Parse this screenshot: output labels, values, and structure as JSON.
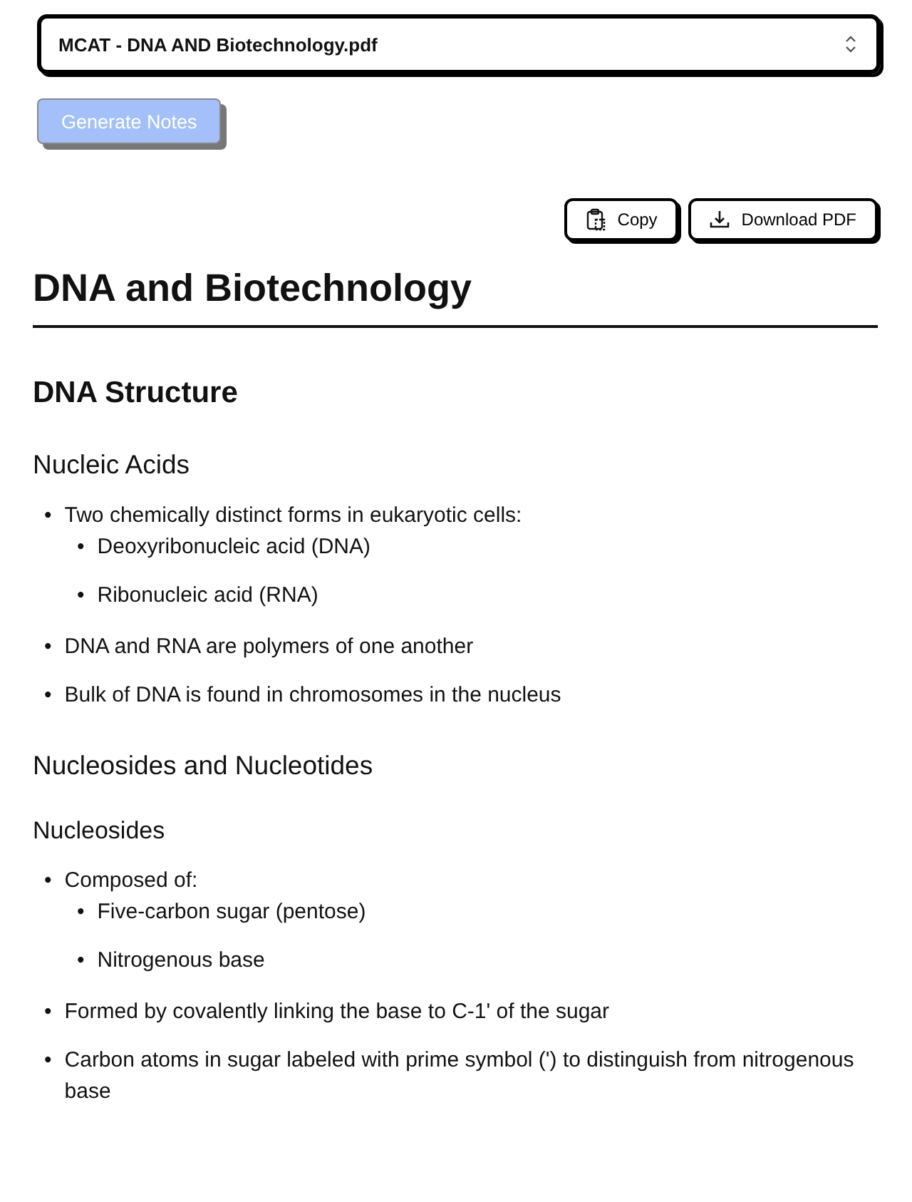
{
  "file_select": {
    "value": "MCAT - DNA AND Biotechnology.pdf"
  },
  "generate_button": {
    "label": "Generate Notes",
    "disabled": true
  },
  "actions": [
    {
      "kind": "copy",
      "label": "Copy"
    },
    {
      "kind": "download",
      "label": "Download PDF"
    }
  ],
  "notes": [
    {
      "kind": "h1",
      "text": "DNA and Biotechnology"
    },
    {
      "kind": "h2",
      "text": "DNA Structure"
    },
    {
      "kind": "h3",
      "text": "Nucleic Acids"
    },
    {
      "kind": "list",
      "items": [
        {
          "marker": "•",
          "text": "Two chemically distinct forms in eukaryotic cells:",
          "children": [
            {
              "marker": "•",
              "text": "Deoxyribonucleic acid (DNA)"
            },
            {
              "marker": "•",
              "text": "Ribonucleic acid (RNA)"
            }
          ]
        },
        {
          "marker": "•",
          "text": "DNA and RNA are polymers of one another"
        },
        {
          "marker": "•",
          "text": "Bulk of DNA is found in chromosomes in the nucleus"
        }
      ]
    },
    {
      "kind": "h3",
      "text": "Nucleosides and Nucleotides"
    },
    {
      "kind": "h4",
      "text": "Nucleosides"
    },
    {
      "kind": "list",
      "items": [
        {
          "marker": "•",
          "text": "Composed of:",
          "children": [
            {
              "marker": "•",
              "text": "Five-carbon sugar (pentose)"
            },
            {
              "marker": "•",
              "text": "Nitrogenous base"
            }
          ]
        },
        {
          "marker": "•",
          "text": "Formed by covalently linking the base to C-1' of the sugar"
        },
        {
          "marker": "•",
          "text": "Carbon atoms in sugar labeled with prime symbol (') to distinguish from nitrogenous base"
        }
      ]
    }
  ]
}
